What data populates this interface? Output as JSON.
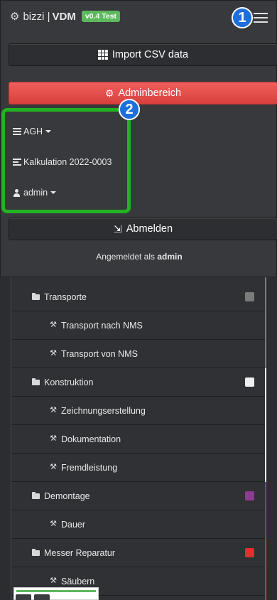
{
  "navbar": {
    "brand_name": "bizzi |",
    "brand_product": "VDM",
    "version_badge": "v0.4 Test"
  },
  "menu": {
    "import_label": "Import CSV data",
    "admin_label": "Adminbereich",
    "org_label": "AGH",
    "calc_label": "Kalkulation 2022-0003",
    "user_label": "admin",
    "logout_label": "Abmelden",
    "signed_in_prefix": "Angemeldet als",
    "signed_in_user": "admin"
  },
  "annotations": {
    "marker_1": "1",
    "marker_2": "2"
  },
  "tree": {
    "rows": [
      {
        "label": "Transporte",
        "kind": "folder",
        "color": "#7b7b7b"
      },
      {
        "label": "Transport nach NMS",
        "kind": "task"
      },
      {
        "label": "Transport von NMS",
        "kind": "task"
      },
      {
        "label": "Konstruktion",
        "kind": "folder",
        "color": "#eeeeee"
      },
      {
        "label": "Zeichnungserstellung",
        "kind": "task"
      },
      {
        "label": "Dokumentation",
        "kind": "task"
      },
      {
        "label": "Fremdleistung",
        "kind": "task"
      },
      {
        "label": "Demontage",
        "kind": "folder",
        "color": "#8a3d8f"
      },
      {
        "label": "Dauer",
        "kind": "task"
      },
      {
        "label": "Messer Reparatur",
        "kind": "folder",
        "color": "#e03030"
      },
      {
        "label": "Säubern",
        "kind": "task"
      }
    ]
  },
  "colors": {
    "accent_green": "#5cb85c",
    "danger_red": "#d9403c",
    "marker_blue": "#1e6fdc",
    "highlight_green": "#22b222"
  }
}
